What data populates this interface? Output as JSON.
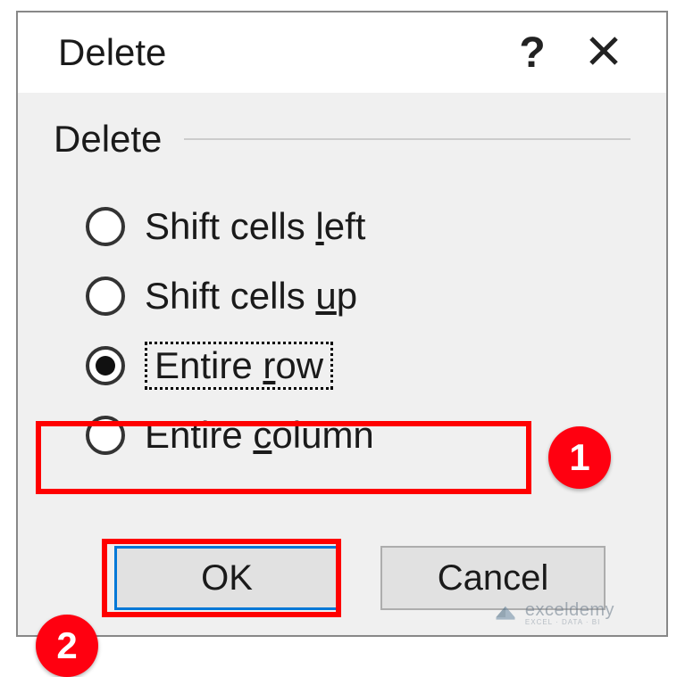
{
  "titlebar": {
    "title": "Delete",
    "help": "?",
    "close": "✕"
  },
  "group": {
    "label": "Delete"
  },
  "options": {
    "shift_left": {
      "pre": "Shift cells ",
      "mn": "l",
      "post": "eft"
    },
    "shift_up": {
      "pre": "Shift cells ",
      "mn": "u",
      "post": "p"
    },
    "entire_row": {
      "pre": "Entire ",
      "mn": "r",
      "post": "ow"
    },
    "entire_col": {
      "pre": "Entire ",
      "mn": "c",
      "post": "olumn"
    }
  },
  "buttons": {
    "ok": "OK",
    "cancel": "Cancel"
  },
  "callouts": {
    "c1": "1",
    "c2": "2"
  },
  "watermark": {
    "main": "exceldemy",
    "sub": "EXCEL · DATA · BI"
  }
}
